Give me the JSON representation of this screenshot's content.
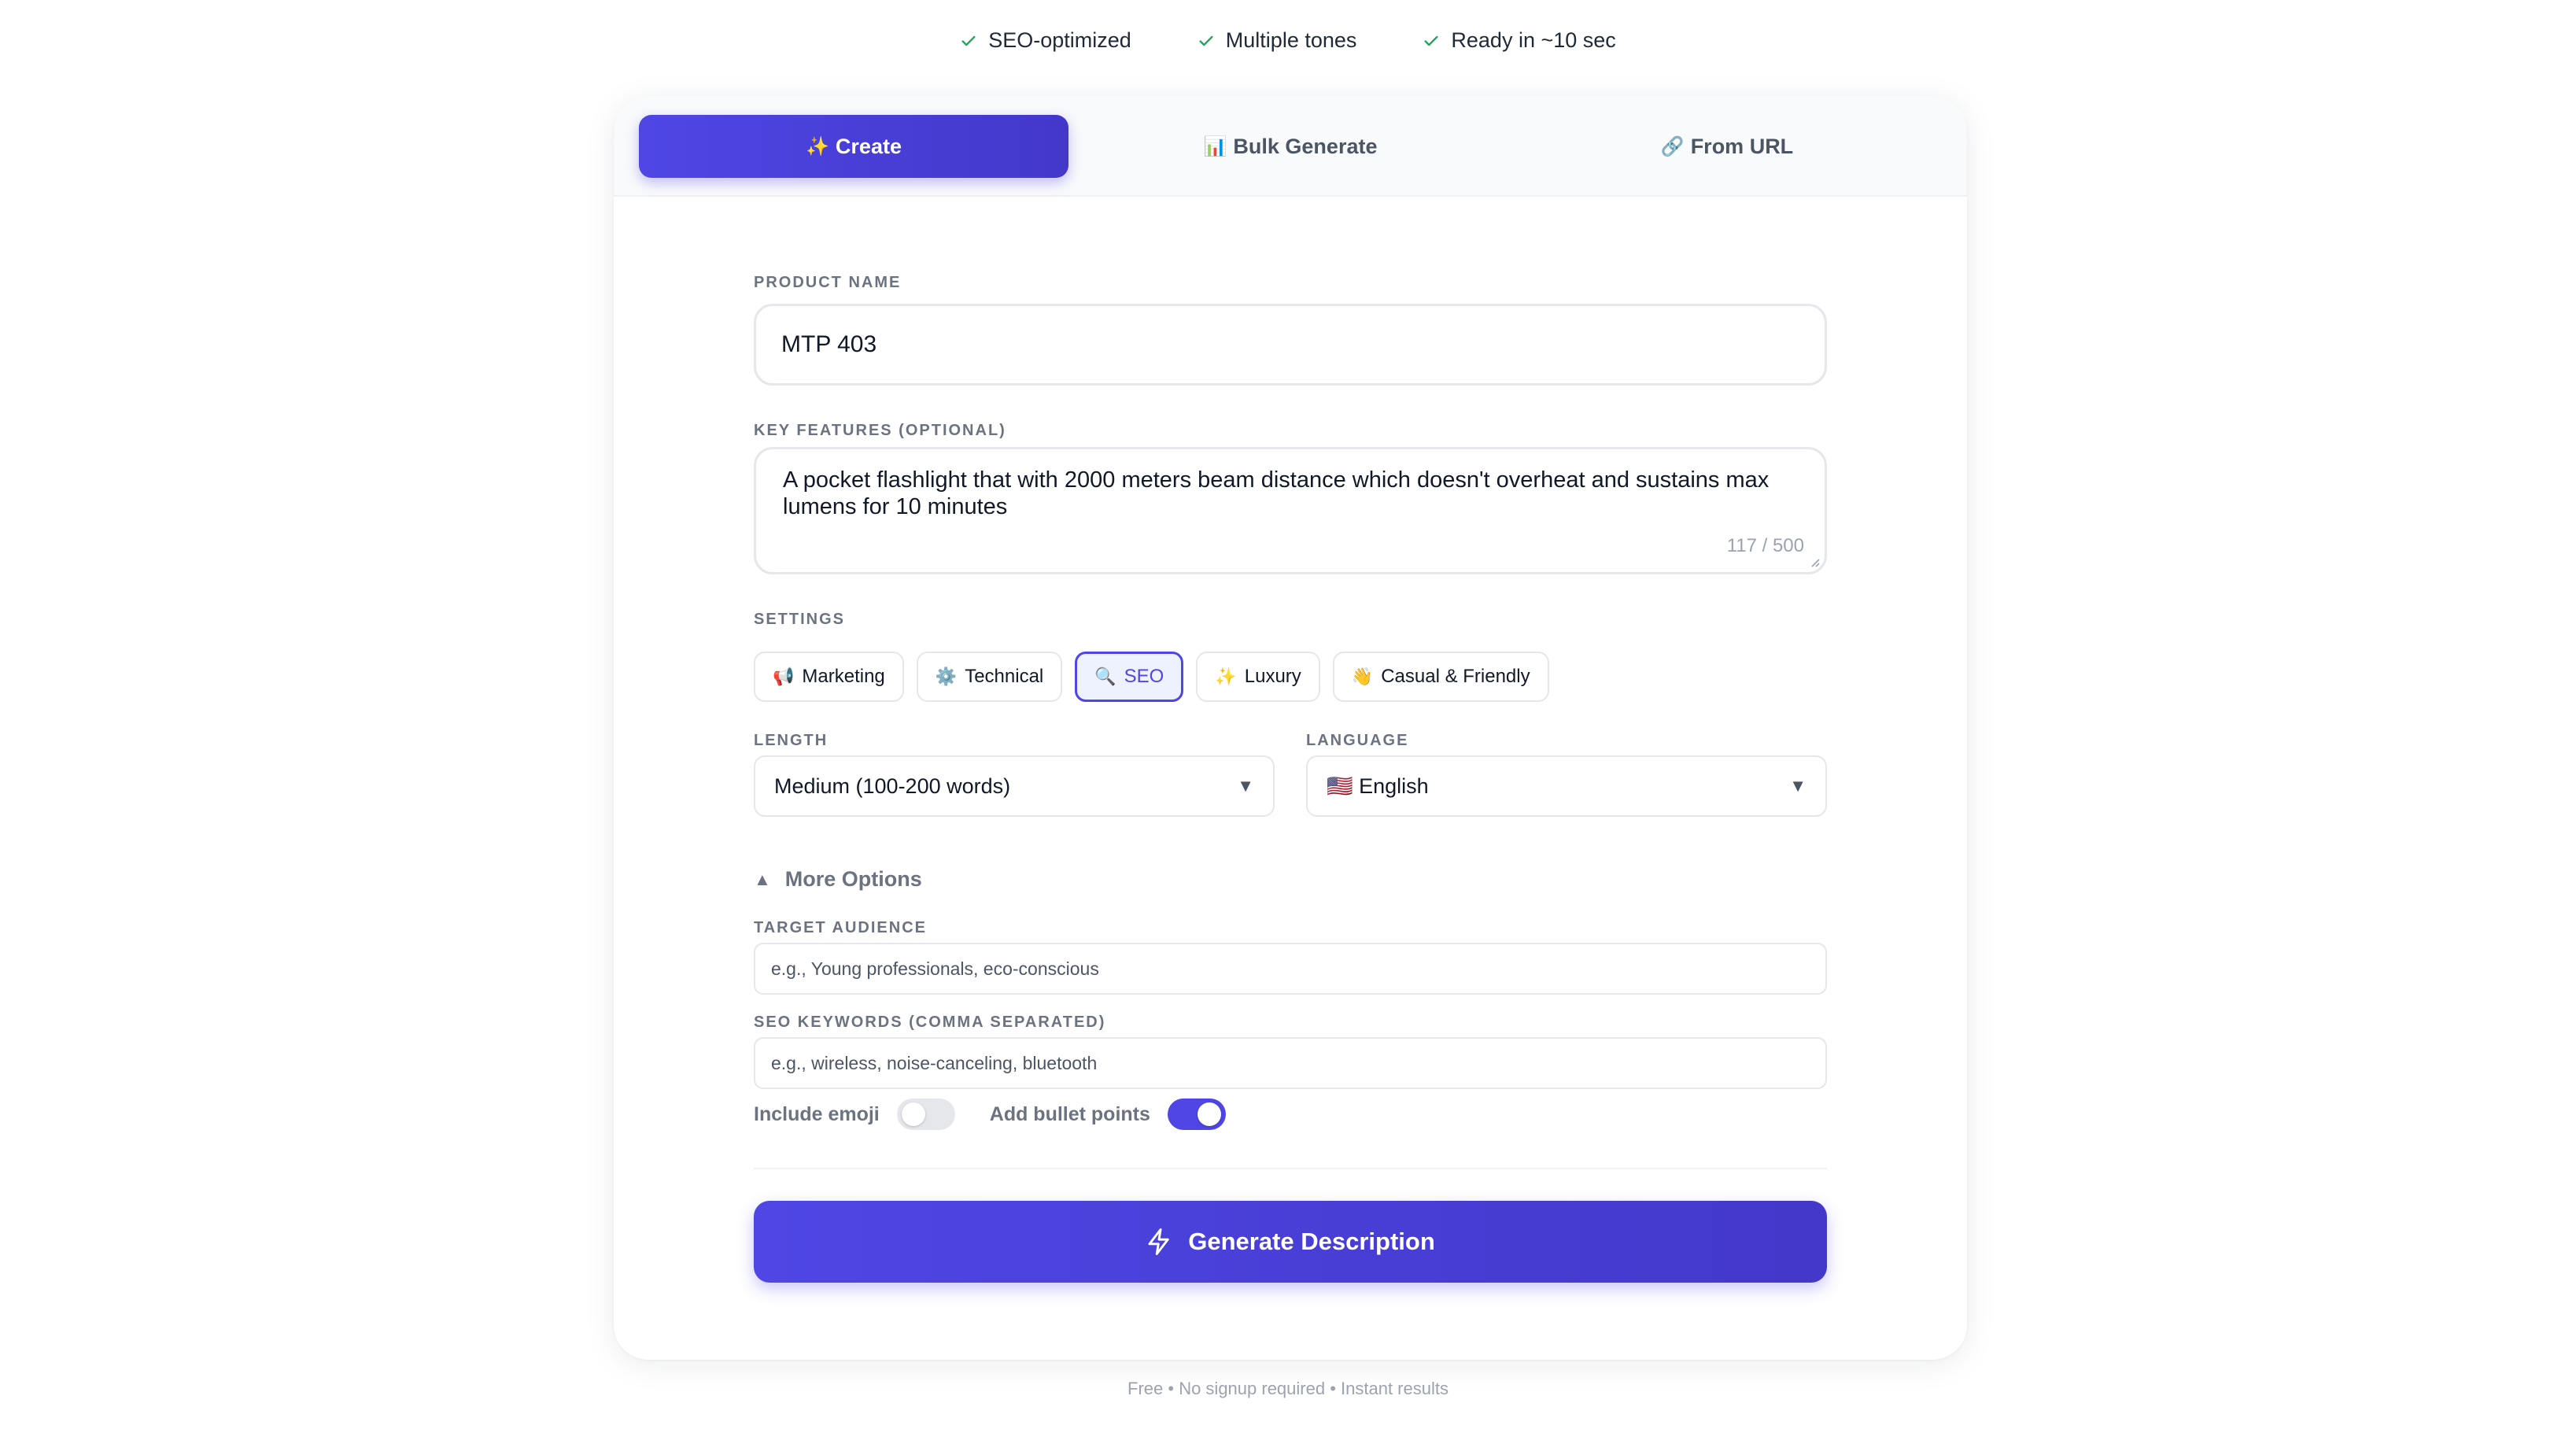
{
  "features": [
    {
      "icon": "check-icon",
      "label": "SEO-optimized"
    },
    {
      "icon": "check-icon",
      "label": "Multiple tones"
    },
    {
      "icon": "check-icon",
      "label": "Ready in ~10 sec"
    }
  ],
  "tabs": [
    {
      "icon": "✨",
      "label": "Create",
      "active": true
    },
    {
      "icon": "📊",
      "label": "Bulk Generate",
      "active": false
    },
    {
      "icon": "🔗",
      "label": "From URL",
      "active": false
    }
  ],
  "form": {
    "product_name_label": "PRODUCT NAME",
    "product_name_value": "MTP 403",
    "features_label": "KEY FEATURES (OPTIONAL)",
    "features_value": "A pocket flashlight that with 2000 meters beam distance which doesn't overheat and sustains max lumens for 10 minutes",
    "features_counter": "117 / 500",
    "settings_label": "SETTINGS",
    "tones": [
      {
        "emoji": "📢",
        "label": "Marketing",
        "selected": false
      },
      {
        "emoji": "⚙️",
        "label": "Technical",
        "selected": false
      },
      {
        "emoji": "🔍",
        "label": "SEO",
        "selected": true
      },
      {
        "emoji": "✨",
        "label": "Luxury",
        "selected": false
      },
      {
        "emoji": "👋",
        "label": "Casual & Friendly",
        "selected": false
      }
    ],
    "length_label": "LENGTH",
    "length_value": "Medium (100-200 words)",
    "language_label": "LANGUAGE",
    "language_value": "🇺🇸 English",
    "more_options": "More Options",
    "audience_label": "TARGET AUDIENCE",
    "audience_placeholder": "e.g., Young professionals, eco-conscious",
    "keywords_label": "SEO KEYWORDS (COMMA SEPARATED)",
    "keywords_placeholder": "e.g., wireless, noise-canceling, bluetooth",
    "emoji_toggle_label": "Include emoji",
    "emoji_toggle_on": false,
    "bullets_toggle_label": "Add bullet points",
    "bullets_toggle_on": true,
    "generate_label": "Generate Description"
  },
  "footer": "Free • No signup required • Instant results",
  "colors": {
    "accent": "#4f46e5",
    "check": "#22a35a"
  }
}
